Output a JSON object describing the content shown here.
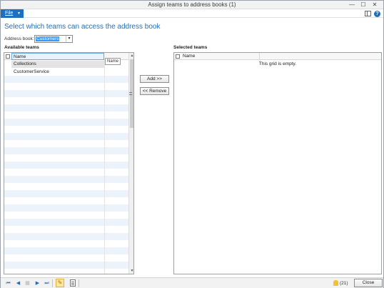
{
  "window": {
    "title": "Assign teams to address books (1)",
    "controls": {
      "minimize": "—",
      "maximize": "☐",
      "close": "✕"
    }
  },
  "menu": {
    "file_label": "File",
    "file_caret": "▾",
    "help_glyph": "?",
    "icons": [
      "layout-icon",
      "help-icon"
    ]
  },
  "heading": "Select which teams can access the address book",
  "address_book": {
    "label": "Address book:",
    "value": "Customers",
    "caret": "▾"
  },
  "available": {
    "title": "Available teams",
    "column_header": "Name",
    "tooltip": "Name",
    "rows": [
      {
        "name": "Collections"
      },
      {
        "name": "CustomerService"
      }
    ],
    "scroll_up": "▲",
    "scroll_down": "▼"
  },
  "actions": {
    "add": "Add >>",
    "remove": "<< Remove"
  },
  "selected": {
    "title": "Selected teams",
    "column_header": "Name",
    "empty_message": "This grid is empty."
  },
  "statusbar": {
    "nav": {
      "first": "⏮",
      "prev": "◀",
      "page": "▦",
      "next": "▶",
      "last": "⏭"
    },
    "edit_glyph": "✎",
    "notifications": "(21)",
    "close_label": "Close"
  },
  "colors": {
    "accent": "#1d6fc2",
    "row_stripe": "#edf3fb",
    "selection": "#3399ff"
  }
}
